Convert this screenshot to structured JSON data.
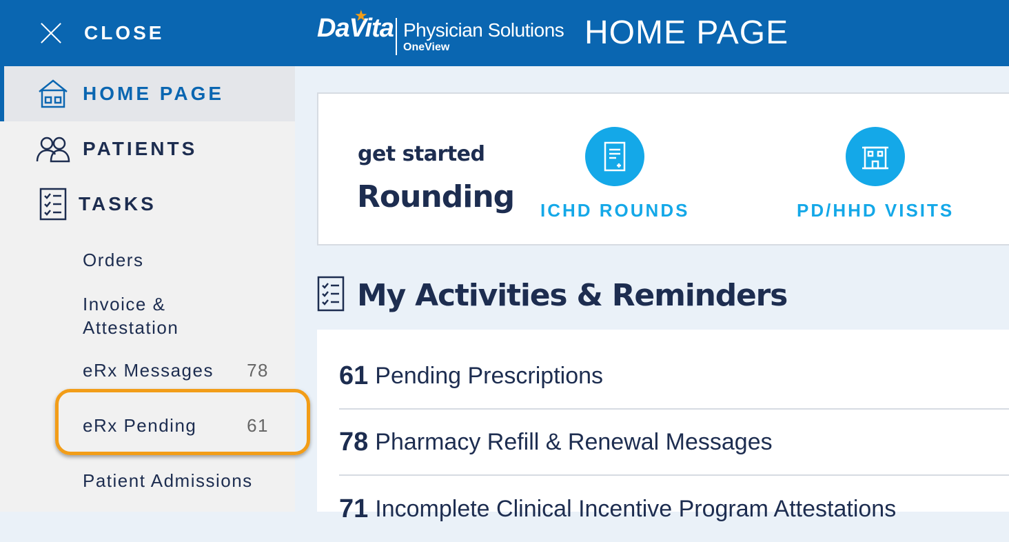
{
  "sidebar": {
    "close_label": "CLOSE",
    "nav": [
      {
        "label": "HOME PAGE",
        "icon": "home-icon",
        "active": true
      },
      {
        "label": "PATIENTS",
        "icon": "patients-icon",
        "active": false
      },
      {
        "label": "TASKS",
        "icon": "tasks-checklist-icon",
        "active": false
      }
    ],
    "tasks": [
      {
        "label_line1": "Orders",
        "label_line2": "",
        "count": ""
      },
      {
        "label_line1": "Invoice &",
        "label_line2": "Attestation",
        "count": ""
      },
      {
        "label_line1": "eRx Messages",
        "label_line2": "",
        "count": "78"
      },
      {
        "label_line1": "eRx Pending",
        "label_line2": "",
        "count": "61"
      },
      {
        "label_line1": "Patient Admissions",
        "label_line2": "",
        "count": ""
      }
    ]
  },
  "header": {
    "logo_brand": "DaVita",
    "logo_product": "Physician Solutions",
    "logo_sub": "OneView",
    "title": "HOME PAGE"
  },
  "rounding": {
    "get_started": "get started",
    "heading": "Rounding",
    "buttons": [
      {
        "label": "ICHD ROUNDS",
        "icon": "document-icon"
      },
      {
        "label": "PD/HHD VISITS",
        "icon": "building-icon"
      }
    ]
  },
  "activities": {
    "heading": "My Activities & Reminders",
    "items": [
      {
        "count": "61",
        "label": "Pending Prescriptions"
      },
      {
        "count": "78",
        "label": "Pharmacy Refill & Renewal Messages"
      },
      {
        "count": "71",
        "label": "Incomplete Clinical Incentive Program Attestations"
      }
    ]
  },
  "colors": {
    "brand_blue": "#0a66b1",
    "accent_cyan": "#14a8e8",
    "highlight_orange": "#f29d18",
    "text_navy": "#1d2d50"
  }
}
